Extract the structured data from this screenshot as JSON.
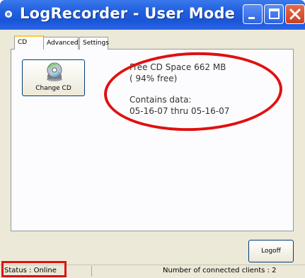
{
  "window": {
    "title": "LogRecorder - User Mode"
  },
  "tabs": [
    {
      "label": "CD",
      "selected": true
    },
    {
      "label": "Advanced",
      "selected": false
    },
    {
      "label": "Settings",
      "selected": false
    }
  ],
  "cd_tab": {
    "change_cd_label": "Change CD",
    "free_space_line": "Free CD Space 662 MB",
    "free_percent_line": "( 94% free)",
    "contains_data_label": "Contains data:",
    "date_range": "05-16-07 thru 05-16-07"
  },
  "buttons": {
    "logoff_label": "Logoff"
  },
  "statusbar": {
    "status": "Status : Online",
    "clients": "Number of connected clients : 2"
  },
  "colors": {
    "titlebar": "#1f5fe0",
    "annotation": "#e01010",
    "window_bg": "#ece9d8"
  },
  "icons": {
    "app": "app-icon",
    "cd": "cd-disc-icon",
    "minimize": "minimize-icon",
    "maximize": "maximize-icon",
    "close": "close-icon"
  }
}
